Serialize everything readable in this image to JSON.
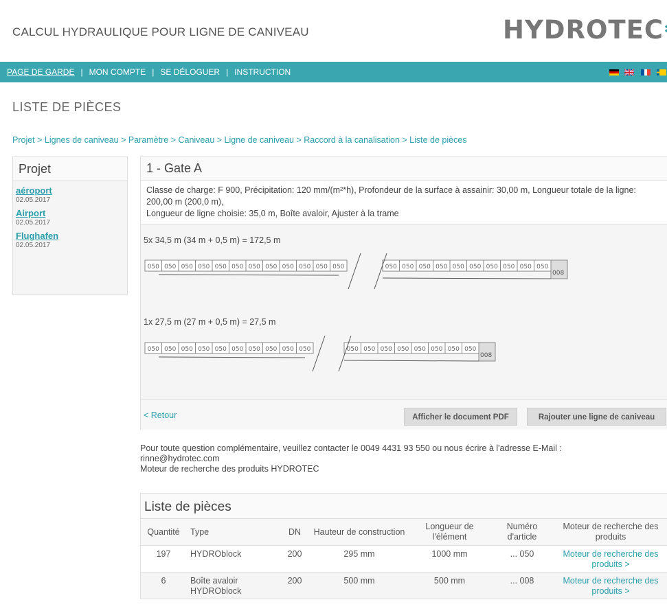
{
  "header": {
    "app_title": "CALCUL HYDRAULIQUE POUR LIGNE DE CANIVEAU",
    "logo_text": "HYDROTEC"
  },
  "nav": {
    "items": [
      "PAGE DE GARDE",
      "MON COMPTE",
      "SE DÉLOGUER",
      "INSTRUCTION"
    ],
    "separator": "|",
    "flags": [
      "flag-de-icon",
      "flag-uk-icon",
      "flag-fr-icon",
      "flag-se-icon"
    ]
  },
  "page_title": "LISTE DE PIÈCES",
  "breadcrumb": "Projet > Lignes de caniveau > Paramètre > Caniveau > Ligne de caniveau > Raccord à la canalisation > Liste de pièces",
  "sidebar": {
    "title": "Projet",
    "projects": [
      {
        "name": "aéroport",
        "date": "02.05.2017"
      },
      {
        "name": "Airport",
        "date": "02.05.2017"
      },
      {
        "name": "Flughafen",
        "date": "02.05.2017"
      }
    ]
  },
  "panel": {
    "title": "1 - Gate A",
    "description_1": "Classe de charge: F 900, Précipitation: 120 mm/(m²*h), Profondeur de la surface à assainir: 30,00 m, Longueur totale de la ligne: 200,00 m (200,0 m),",
    "description_2": "Longueur de ligne choisie: 35,0 m, Boîte avaloir, Ajuster à la trame",
    "line1_label": "5x 34,5 m (34 m + 0,5 m) = 172,5 m",
    "line2_label": "1x 27,5 m (27 m + 0,5 m) = 27,5 m",
    "segment_code": "050",
    "end_code": "008",
    "back_link": "< Retour",
    "pdf_button": "Afficher le document PDF",
    "add_button": "Rajouter une ligne de caniveau"
  },
  "contact": {
    "line1": "Pour toute question complémentaire, veuillez contacter le 0049 4431 93 550 ou nous écrire à l'adresse E-Mail :",
    "email": "rinne@hydrotec.com",
    "line3": "Moteur de recherche des produits HYDROTEC"
  },
  "parts": {
    "title": "Liste de pièces",
    "headers": [
      "Quantité",
      "Type",
      "DN",
      "Hauteur de construction",
      "Longueur de l'élément",
      "Numéro d'article",
      "Moteur de recherche des produits"
    ],
    "rows": [
      {
        "qty": "197",
        "type": "HYDROblock",
        "dn": "200",
        "height": "295 mm",
        "length": "1000 mm",
        "article": "... 050",
        "link": "Moteur de recherche des produits >"
      },
      {
        "qty": "6",
        "type": "Boîte avaloir HYDROblock",
        "dn": "200",
        "height": "500 mm",
        "length": "500 mm",
        "article": "... 008",
        "link": "Moteur de recherche des produits >"
      }
    ]
  },
  "colors": {
    "accent": "#3aa6b0",
    "link": "#2a9eab"
  }
}
